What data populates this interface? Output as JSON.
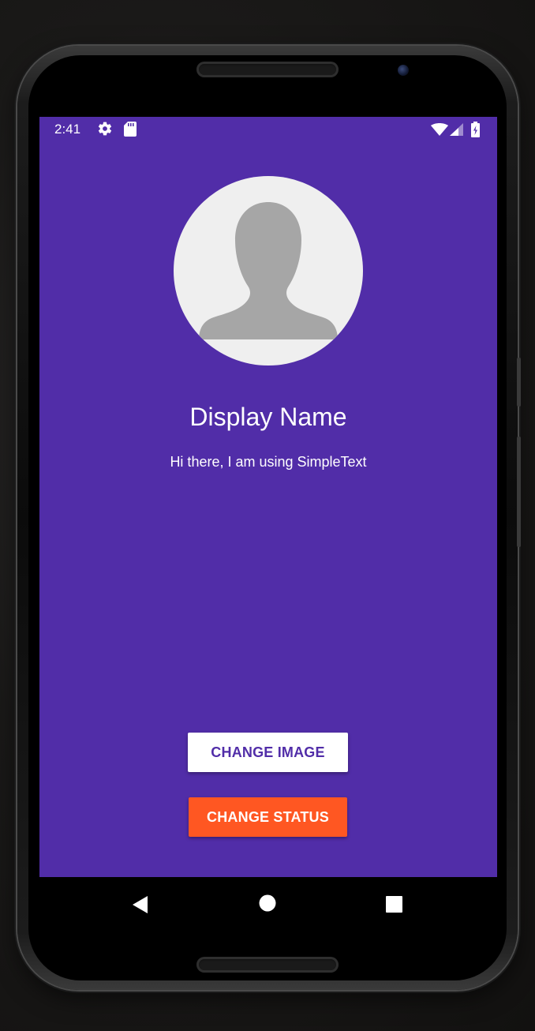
{
  "status_bar": {
    "time": "2:41",
    "left_icons": [
      "settings-icon",
      "sd-card-icon"
    ],
    "right_icons": [
      "wifi-icon",
      "cell-signal-icon",
      "battery-charging-icon"
    ]
  },
  "profile": {
    "display_name": "Display Name",
    "status": "Hi there, I am using SimpleText",
    "avatar_icon": "default-avatar-icon"
  },
  "buttons": {
    "change_image": "CHANGE IMAGE",
    "change_status": "CHANGE STATUS"
  },
  "nav_bar": {
    "buttons": [
      "back-icon",
      "home-icon",
      "recents-icon"
    ]
  },
  "colors": {
    "primary": "#512da8",
    "accent": "#ff5722",
    "avatar_bg": "#efefef",
    "avatar_silhouette": "#a6a6a6"
  }
}
